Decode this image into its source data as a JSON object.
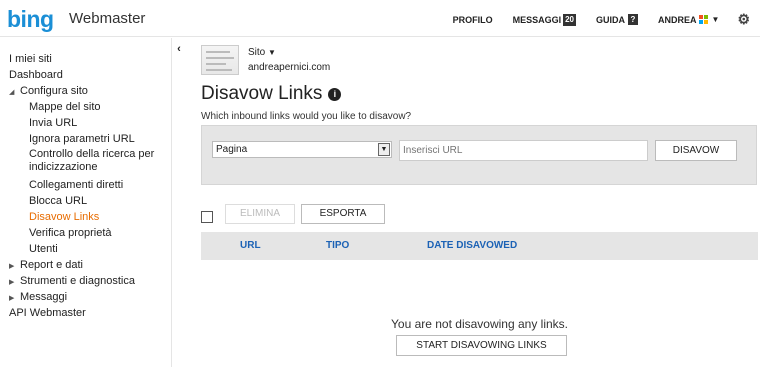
{
  "header": {
    "logo": "bing",
    "product": "Webmaster",
    "nav": {
      "profile": "PROFILO",
      "messages": "MESSAGGI",
      "messages_count": "20",
      "help": "GUIDA",
      "help_badge": "?",
      "user": "ANDREA"
    }
  },
  "sidebar": {
    "items": [
      {
        "label": "I miei siti"
      },
      {
        "label": "Dashboard"
      },
      {
        "label": "Configura sito"
      },
      {
        "label": "Mappe del sito"
      },
      {
        "label": "Invia URL"
      },
      {
        "label": "Ignora parametri URL"
      },
      {
        "label": "Controllo della ricerca per indicizzazione"
      },
      {
        "label": "Collegamenti diretti"
      },
      {
        "label": "Blocca URL"
      },
      {
        "label": "Disavow Links"
      },
      {
        "label": "Verifica proprietà"
      },
      {
        "label": "Utenti"
      },
      {
        "label": "Report e dati"
      },
      {
        "label": "Strumenti e diagnostica"
      },
      {
        "label": "Messaggi"
      },
      {
        "label": "API Webmaster"
      }
    ]
  },
  "site": {
    "label": "Sito",
    "url": "andreapernici.com"
  },
  "main": {
    "title": "Disavow Links",
    "question": "Which inbound links would you like to disavow?",
    "select_value": "Pagina",
    "url_placeholder": "Inserisci URL",
    "disavow_button": "DISAVOW",
    "delete_button": "ELIMINA",
    "export_button": "ESPORTA",
    "columns": [
      "URL",
      "TIPO",
      "DATE DISAVOWED"
    ],
    "empty_message": "You are not disavowing any links.",
    "start_button": "START DISAVOWING LINKS"
  }
}
